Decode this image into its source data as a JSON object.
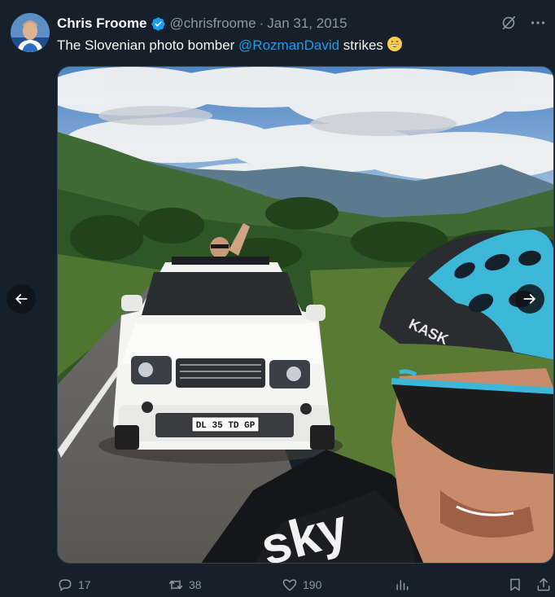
{
  "tweet": {
    "author_name": "Chris Froome",
    "handle": "@chrisfroome",
    "separator": "·",
    "date": "Jan 31, 2015",
    "text_before": "The Slovenian photo bomber ",
    "mention": "@RozmanDavid",
    "text_after": " strikes",
    "emoji": "grinning-face-emoji"
  },
  "media": {
    "plate_text": "DL 35 TD GP",
    "jersey_text": "sky",
    "helmet_text": "KASK",
    "prev_icon": "arrow-left-icon",
    "next_icon": "arrow-right-icon"
  },
  "actions": {
    "replies": "17",
    "retweets": "38",
    "likes": "190"
  },
  "colors": {
    "background": "#15202b",
    "link": "#1d9bf0",
    "secondary_text": "#8b98a5",
    "verified": "#1d9bf0"
  }
}
